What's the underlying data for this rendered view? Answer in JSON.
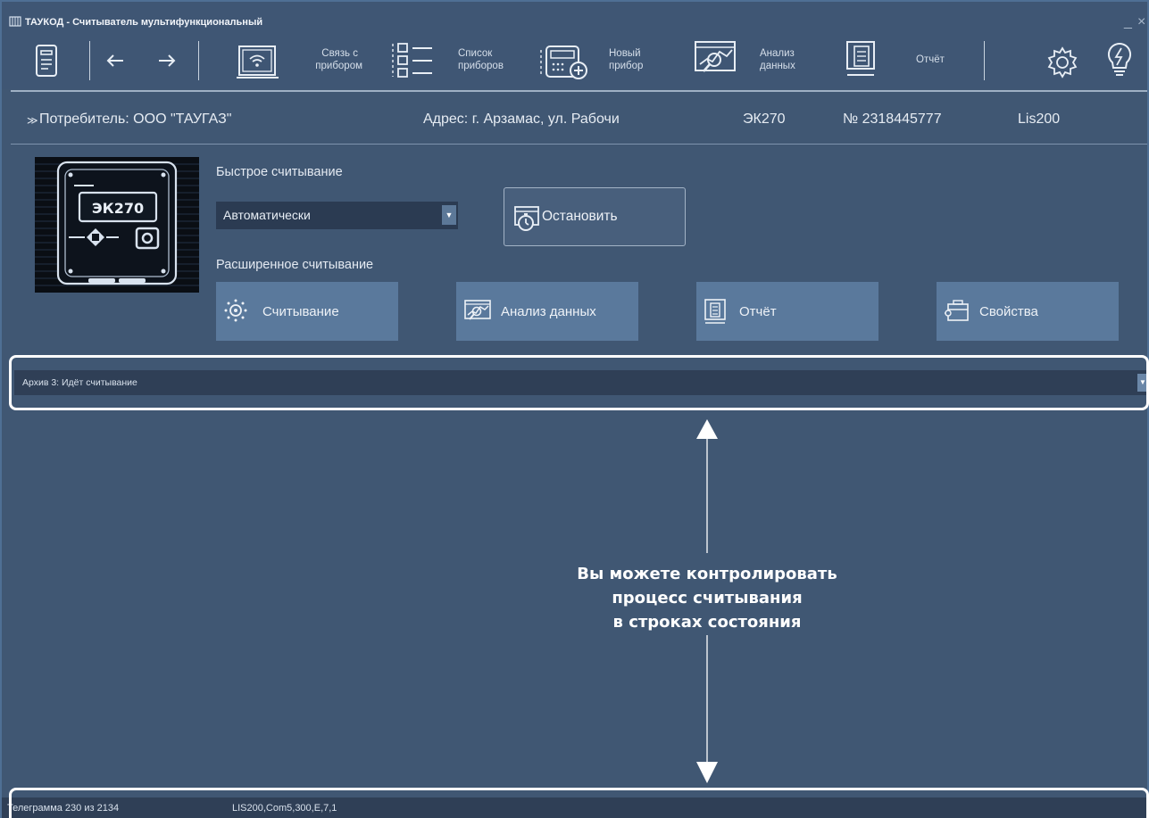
{
  "window": {
    "title": "ТАУКОД - Считыватель мультифункциональный",
    "minimize_glyph": "_",
    "close_glyph": "×"
  },
  "toolbar": {
    "connect": [
      "Связь с",
      "прибором"
    ],
    "device_list": [
      "Список",
      "приборов"
    ],
    "new_device": [
      "Новый",
      "прибор"
    ],
    "analysis": [
      "Анализ",
      "данных"
    ],
    "report": "Отчёт",
    "icons": [
      "document-list-icon",
      "back-arrow-icon",
      "forward-arrow-icon",
      "wifi-monitor-icon",
      "list-icon",
      "new-device-icon",
      "chart-analysis-icon",
      "report-icon",
      "settings-icon",
      "lightbulb-icon"
    ]
  },
  "info": {
    "consumer": "Потребитель: ООО \"ТАУГАЗ\"",
    "address": "Адрес: г. Арзамас, ул. Рабочи",
    "model": "ЭК270",
    "serial": "№ 2318445777",
    "protocol": "Lis200",
    "collapse_glyph": "≫"
  },
  "device_image": {
    "display_text": "ЭК270"
  },
  "quick_read": {
    "label": "Быстрое считывание",
    "mode_value": "Автоматически",
    "stop_label": "Остановить"
  },
  "extended_read": {
    "label": "Расширенное считывание",
    "buttons": [
      "Считывание",
      "Анализ данных",
      "Отчёт",
      "Свойства"
    ]
  },
  "status": {
    "archive": "Архив 3: Идёт считывание",
    "telegram": "Телеграмма 230 из 2134",
    "connection": "LIS200,Com5,300,E,7,1"
  },
  "annotation": {
    "lines": [
      "Вы можете контролировать",
      "процесс считывания",
      "в строках состояния"
    ]
  },
  "colors": {
    "background": "#405773",
    "button": "#5a799c",
    "highlight": "#ffffff",
    "status_bar": "#2f3f56"
  }
}
